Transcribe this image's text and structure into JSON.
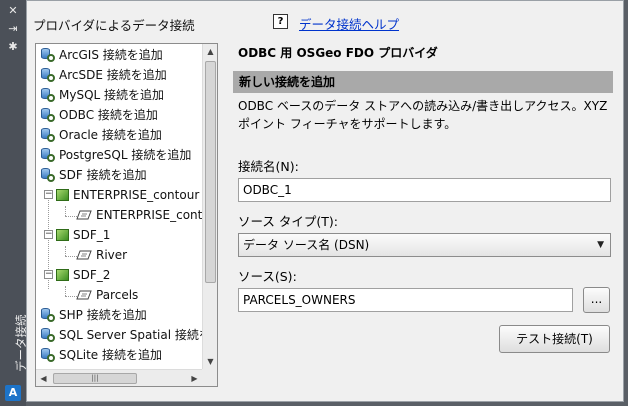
{
  "palette": {
    "title": "データ接続",
    "close_glyph": "✕",
    "autohide_glyph": "⇥",
    "props_glyph": "✱",
    "logo_glyph": "A"
  },
  "header": {
    "providers_label": "プロバイダによるデータ接続",
    "help_glyph": "?",
    "help_link": "データ接続ヘルプ"
  },
  "tree": {
    "items": [
      {
        "label": "ArcGIS 接続を追加",
        "icon": "database-connect-icon"
      },
      {
        "label": "ArcSDE 接続を追加",
        "icon": "database-connect-icon"
      },
      {
        "label": "MySQL 接続を追加",
        "icon": "database-connect-icon"
      },
      {
        "label": "ODBC 接続を追加",
        "icon": "database-connect-icon"
      },
      {
        "label": "Oracle 接続を追加",
        "icon": "database-connect-icon"
      },
      {
        "label": "PostgreSQL 接続を追加",
        "icon": "database-connect-icon"
      },
      {
        "label": "SDF 接続を追加",
        "icon": "database-connect-icon"
      },
      {
        "label": "ENTERPRISE_contour",
        "icon": "feature-source-icon"
      },
      {
        "label": "ENTERPRISE_cont",
        "icon": "feature-layer-icon"
      },
      {
        "label": "SDF_1",
        "icon": "feature-source-icon"
      },
      {
        "label": "River",
        "icon": "feature-layer-icon"
      },
      {
        "label": "SDF_2",
        "icon": "feature-source-icon"
      },
      {
        "label": "Parcels",
        "icon": "feature-layer-icon"
      },
      {
        "label": "SHP 接続を追加",
        "icon": "database-connect-icon"
      },
      {
        "label": "SQL Server Spatial 接続を",
        "icon": "database-connect-icon"
      },
      {
        "label": "SQLite 接続を追加",
        "icon": "database-connect-icon"
      }
    ],
    "expand_glyph": "−",
    "scroll_up": "▲",
    "scroll_down": "▼",
    "scroll_left": "◀",
    "scroll_right": "▶",
    "grip": "|||"
  },
  "form": {
    "provider_title": "ODBC 用 OSGeo FDO プロバイダ",
    "section_header": "新しい接続を追加",
    "description": "ODBC ベースのデータ ストアへの読み込み/書き出しアクセス。XYZ ポイント フィーチャをサポートします。",
    "connection_name_label": "接続名(N):",
    "connection_name_value": "ODBC_1",
    "source_type_label": "ソース タイプ(T):",
    "source_type_value": "データ ソース名 (DSN)",
    "source_label": "ソース(S):",
    "source_value": "PARCELS_OWNERS",
    "browse_label": "...",
    "test_button": "テスト接続(T)"
  }
}
